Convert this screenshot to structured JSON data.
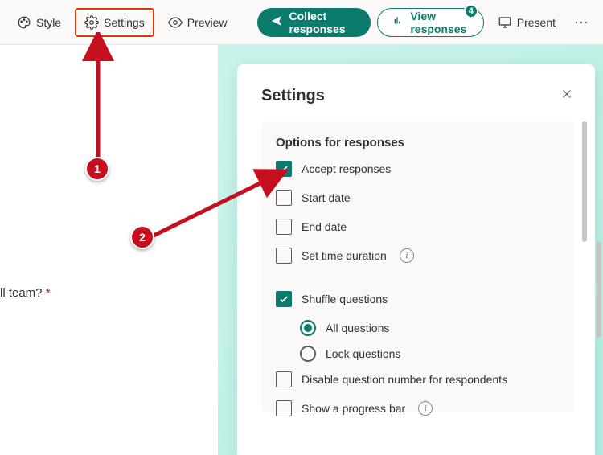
{
  "toolbar": {
    "style": "Style",
    "settings": "Settings",
    "preview": "Preview",
    "collect": "Collect responses",
    "view": "View responses",
    "view_badge": "4",
    "present": "Present"
  },
  "left": {
    "question_fragment": "ll team? ",
    "required_mark": "*"
  },
  "panel": {
    "title": "Settings",
    "section": "Options for responses",
    "opts": {
      "accept": {
        "label": "Accept responses",
        "checked": true
      },
      "start": {
        "label": "Start date",
        "checked": false
      },
      "end": {
        "label": "End date",
        "checked": false
      },
      "duration": {
        "label": "Set time duration",
        "checked": false
      },
      "shuffle": {
        "label": "Shuffle questions",
        "checked": true
      },
      "radio_all": {
        "label": "All questions",
        "selected": true
      },
      "radio_lock": {
        "label": "Lock questions",
        "selected": false
      },
      "disable_num": {
        "label": "Disable question number for respondents",
        "checked": false
      },
      "progress": {
        "label": "Show a progress bar",
        "checked": false
      }
    }
  },
  "annotations": {
    "one": "1",
    "two": "2"
  }
}
